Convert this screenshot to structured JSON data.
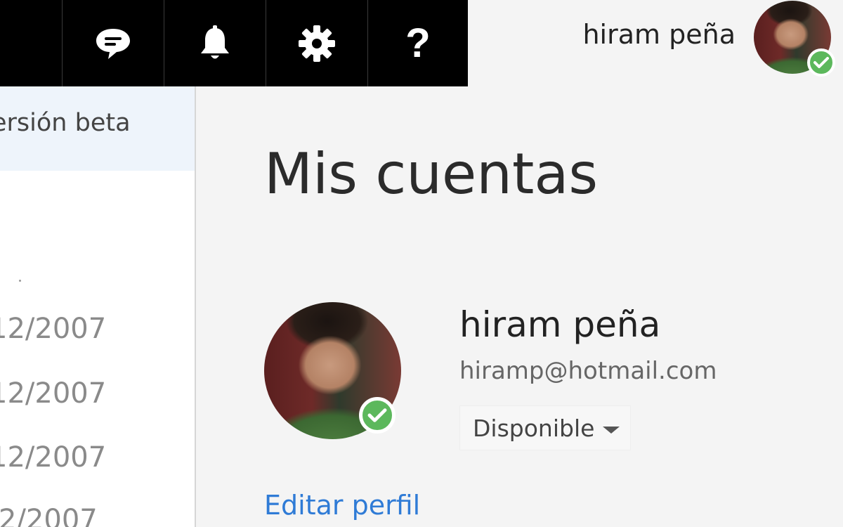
{
  "toolbar": {
    "items": [
      {
        "name": "chat",
        "icon": "chat-icon"
      },
      {
        "name": "notifications",
        "icon": "bell-icon"
      },
      {
        "name": "settings",
        "icon": "gear-icon"
      },
      {
        "name": "help",
        "icon": "help-icon",
        "glyph": "?"
      }
    ]
  },
  "header": {
    "user_name": "hiram peña",
    "status_color": "#5cb85c"
  },
  "sidebar": {
    "banner_text": "ersión beta",
    "dates": [
      "12/2007",
      "12/2007",
      "12/2007",
      "2/2007"
    ]
  },
  "main": {
    "title": "Mis cuentas",
    "profile": {
      "name": "hiram peña",
      "email": "hiramp@hotmail.com",
      "status": "Disponible"
    },
    "edit_link": "Editar perfil"
  },
  "colors": {
    "toolbar_bg": "#000000",
    "accent_link": "#2f7bd6",
    "presence_green": "#5cb85c",
    "beta_banner_bg": "#eef4fb"
  }
}
